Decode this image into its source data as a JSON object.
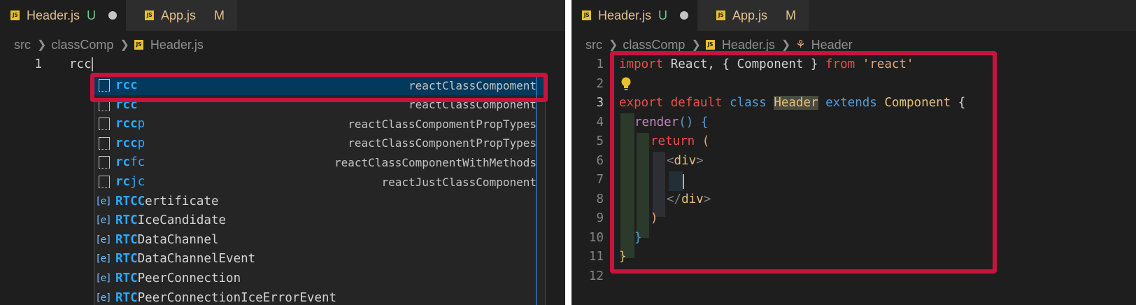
{
  "left": {
    "tabs": [
      {
        "title": "Header.js",
        "status": "U",
        "active": true,
        "dirty": true,
        "icon": "JS"
      },
      {
        "title": "App.js",
        "status": "M",
        "active": false,
        "dirty": false,
        "icon": "JS"
      }
    ],
    "breadcrumb": [
      "src",
      "classComp",
      "Header.js"
    ],
    "line_number": "1",
    "typed_text": "rcc",
    "suggestions": [
      {
        "match": "rcc",
        "rest": "",
        "detail": "reactClassCompoment",
        "kind": "snippet",
        "selected": true
      },
      {
        "match": "rcc",
        "rest": "",
        "detail": "reactClassComponent",
        "kind": "snippet"
      },
      {
        "match": "rcc",
        "rest": "p",
        "detail": "reactClassCompomentPropTypes",
        "kind": "snippet"
      },
      {
        "match": "rcc",
        "rest": "p",
        "detail": "reactClassComponentPropTypes",
        "kind": "snippet"
      },
      {
        "match": "rc",
        "rest": "fc",
        "detail": "reactClassComponentWithMethods",
        "kind": "snippet"
      },
      {
        "match": "rc",
        "rest": "jc",
        "detail": "reactJustClassComponent",
        "kind": "snippet"
      },
      {
        "match": "RTCC",
        "rest": "ertificate",
        "detail": "",
        "kind": "variable"
      },
      {
        "match": "RTC",
        "rest": "IceCandidate",
        "detail": "",
        "kind": "variable"
      },
      {
        "match": "RTC",
        "rest": "DataChannel",
        "detail": "",
        "kind": "variable"
      },
      {
        "match": "RTC",
        "rest": "DataChannelEvent",
        "detail": "",
        "kind": "variable"
      },
      {
        "match": "RTC",
        "rest": "PeerConnection",
        "detail": "",
        "kind": "variable"
      },
      {
        "match": "RTC",
        "rest": "PeerConnectionIceErrorEvent",
        "detail": "",
        "kind": "variable"
      }
    ]
  },
  "right": {
    "tabs": [
      {
        "title": "Header.js",
        "status": "U",
        "active": true,
        "dirty": true,
        "icon": "JS"
      },
      {
        "title": "App.js",
        "status": "M",
        "active": false,
        "dirty": false,
        "icon": "JS"
      }
    ],
    "breadcrumb": [
      "src",
      "classComp",
      "Header.js",
      "Header"
    ],
    "line_numbers": [
      "1",
      "2",
      "3",
      "4",
      "5",
      "6",
      "7",
      "8",
      "9",
      "10",
      "11",
      "12"
    ],
    "code": {
      "l1": {
        "kw_import": "import",
        "t1": " React, { Component } ",
        "kw_from": "from",
        "sp": " ",
        "str": "'react'"
      },
      "l3": {
        "kw_export": "export",
        "sp1": " ",
        "kw_default": "default",
        "sp2": " ",
        "kw_class": "class",
        "sp3": " ",
        "name": "Header",
        "sp4": " ",
        "kw_extends": "extends",
        "sp5": " ",
        "base": "Component",
        "brace": " {"
      },
      "l4": {
        "fn": "render",
        "rest": "() {"
      },
      "l5": {
        "kw_return": "return",
        "rest": " ("
      },
      "l6": {
        "open": "<",
        "tag": "div",
        "close": ">"
      },
      "l8": {
        "open": "</",
        "tag": "div",
        "close": ">"
      },
      "l9": ")",
      "l10": "}",
      "l11": "}"
    }
  },
  "colors": {
    "highlight": "#c8133d",
    "editor_bg": "#1e1e1e",
    "match": "#2aaaff"
  }
}
